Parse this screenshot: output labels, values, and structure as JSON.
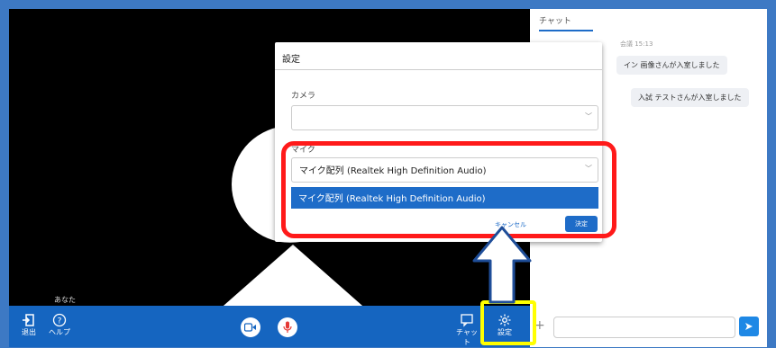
{
  "video": {
    "participant_label": "あなた"
  },
  "toolbar": {
    "leave_label": "退出",
    "help_label": "ヘルプ",
    "chat_label": "チャット",
    "settings_label": "設定"
  },
  "chat": {
    "tab_label": "チャット",
    "meta": "会議 15:13",
    "messages": [
      "イン 画像さんが入室しました",
      "入試 テストさんが入室しました"
    ],
    "input_placeholder": ""
  },
  "dialog": {
    "title": "設定",
    "camera_label": "カメラ",
    "camera_value": "",
    "mic_label": "マイク",
    "mic_value": "マイク配列 (Realtek High Definition Audio)",
    "mic_options": [
      "マイク配列 (Realtek High Definition Audio)"
    ],
    "cancel_label": "キャンセル",
    "ok_label": "決定"
  },
  "colors": {
    "frame": "#3d79c4",
    "toolbar": "#1565c0",
    "accent": "#1e6cc8",
    "highlight_red": "#ff1a1a",
    "highlight_yellow": "#ffff00"
  }
}
